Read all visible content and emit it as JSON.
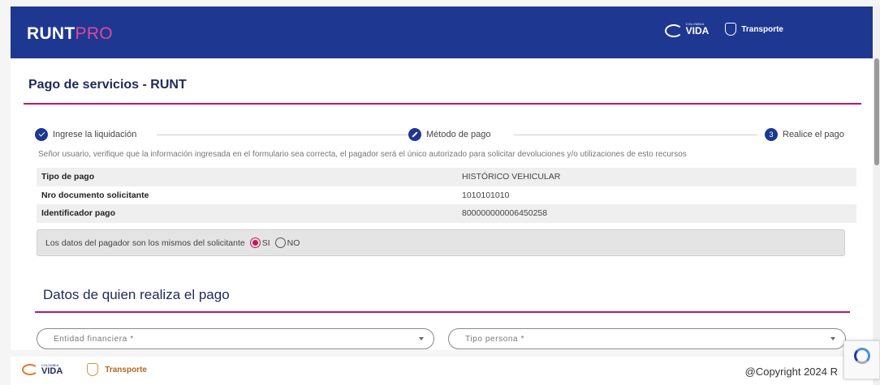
{
  "header": {
    "brand_main": "RUNT",
    "brand_sub": "PRO",
    "colombia_small": "COLOMBIA",
    "vida_big": "VIDA",
    "transporte": "Transporte"
  },
  "page": {
    "title": "Pago de servicios - RUNT"
  },
  "stepper": {
    "steps": [
      {
        "label": "Ingrese la liquidación",
        "icon": "check-icon"
      },
      {
        "label": "Método de pago",
        "icon": "pencil-icon"
      },
      {
        "label": "Realice el pago",
        "number": "3"
      }
    ]
  },
  "notice": "Señor usuario, verifique que la información ingresada en el formulario sea correcta, el pagador será el único autorizado para solicitar devoluciones y/o utilizaciones de esto recursos",
  "info": [
    {
      "label": "Tipo de pago",
      "value": "HISTÓRICO VEHICULAR"
    },
    {
      "label": "Nro documento solicitante",
      "value": "1010101010"
    },
    {
      "label": "Identificador pago",
      "value": "800000000006450258"
    }
  ],
  "payer": {
    "question": "Los datos del pagador son los mismos del solicitante",
    "yes_label": "SI",
    "no_label": "NO",
    "selected": "SI"
  },
  "payment_section": {
    "title": "Datos de quien realiza el pago",
    "entity_placeholder": "Entidad financiera *",
    "person_type_placeholder": "Tipo persona *"
  },
  "footer": {
    "colombia_small": "COLOMBIA",
    "vida_big": "VIDA",
    "transporte": "Transporte",
    "copyright": "@Copyright 2024 R"
  },
  "colors": {
    "primary": "#1e3791",
    "accent": "#c2185b",
    "brand_pink": "#e0479e"
  }
}
